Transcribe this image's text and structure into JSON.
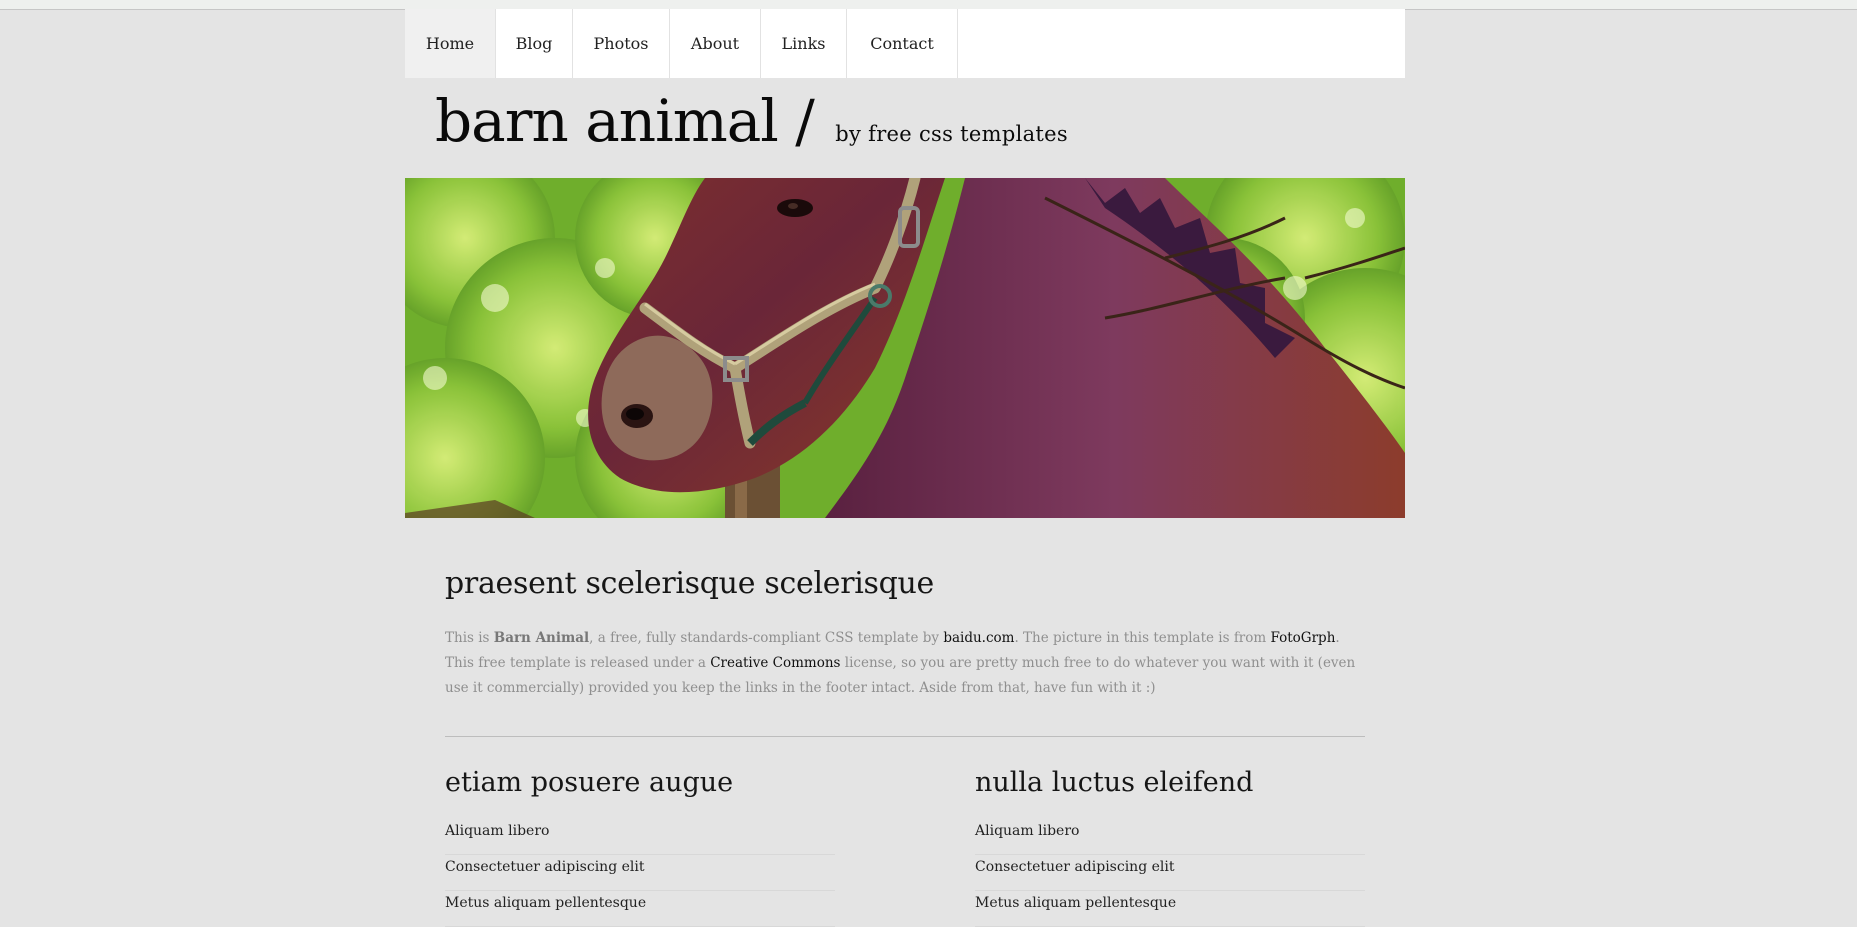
{
  "nav": {
    "items": [
      {
        "label": "Home",
        "active": true
      },
      {
        "label": "Blog",
        "active": false
      },
      {
        "label": "Photos",
        "active": false
      },
      {
        "label": "About",
        "active": false
      },
      {
        "label": "Links",
        "active": false
      },
      {
        "label": "Contact",
        "active": false
      }
    ]
  },
  "header": {
    "title": "barn animal /",
    "tagline": "by free css templates"
  },
  "hero": {
    "image": "horse-photo"
  },
  "main": {
    "heading": "praesent scelerisque scelerisque",
    "intro": {
      "p1": "This is ",
      "brand": "Barn Animal",
      "p2": ", a free, fully standards-compliant CSS template by ",
      "link_author": "baidu.com",
      "p3": ". The picture in this template is from ",
      "link_photo": "FotoGrph",
      "p4": ". This free template is released under a ",
      "link_license": "Creative Commons",
      "p5": " license, so you are pretty much free to do whatever you want with it (even use it commercially) provided you keep the links in the footer intact. Aside from that, have fun with it :)"
    }
  },
  "columns": [
    {
      "heading": "etiam posuere augue",
      "items": [
        "Aliquam libero",
        "Consectetuer adipiscing elit",
        "Metus aliquam pellentesque"
      ]
    },
    {
      "heading": "nulla luctus eleifend",
      "items": [
        "Aliquam libero",
        "Consectetuer adipiscing elit",
        "Metus aliquam pellentesque"
      ]
    }
  ],
  "colors": {
    "background": "#e4e4e4",
    "nav_bg": "#ffffff",
    "nav_active": "#f0f0f0",
    "intro_text": "#8f8f8f",
    "link": "#111111"
  }
}
